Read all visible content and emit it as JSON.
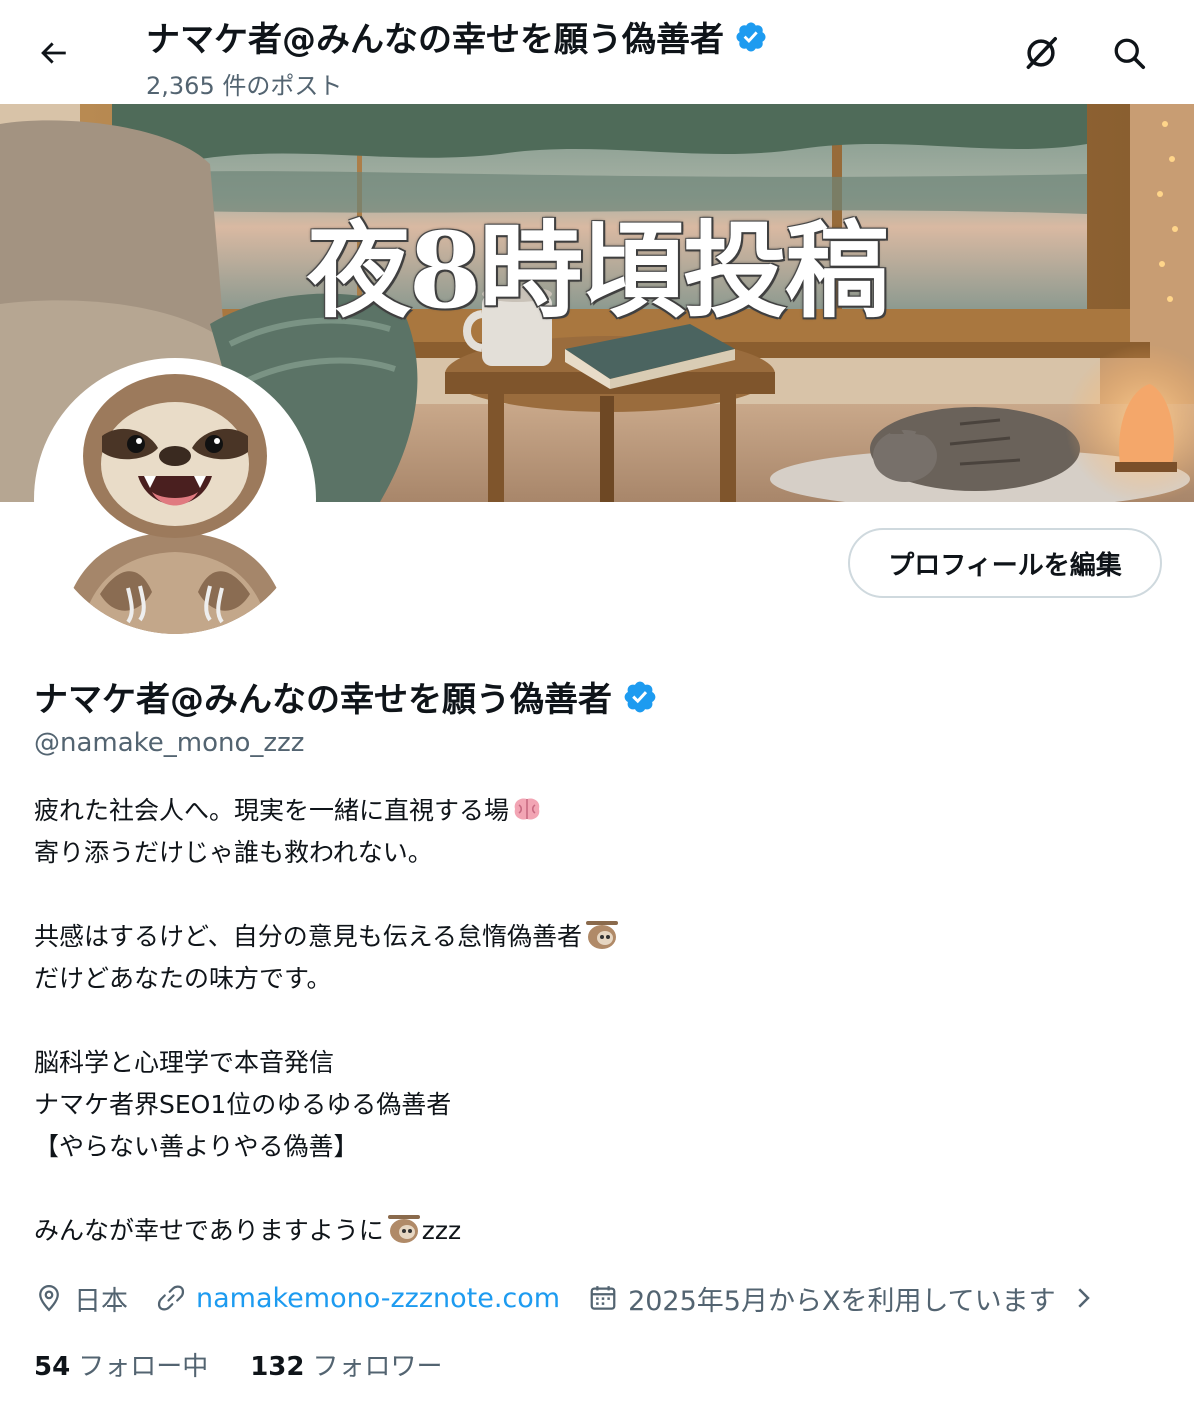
{
  "header": {
    "title": "ナマケ者@みんなの幸せを願う偽善者",
    "post_count": "2,365 件のポスト",
    "back_icon": "arrow-left-icon",
    "grok_icon": "grok-icon",
    "search_icon": "search-icon"
  },
  "banner": {
    "text": "夜8時頃投稿"
  },
  "profile": {
    "edit_button": "プロフィールを編集",
    "display_name": "ナマケ者@みんなの幸せを願う偽善者",
    "handle": "@namake_mono_zzz",
    "verified_color": "#1d9bf0",
    "bio_lines": [
      "疲れた社会人へ。現実を一緒に直視する場",
      "寄り添うだけじゃ誰も救われない。",
      "",
      "共感はするけど、自分の意見も伝える怠惰偽善者",
      "だけどあなたの味方です。",
      "",
      "脳科学と心理学で本音発信",
      "ナマケ者界SEO1位のゆるゆる偽善者",
      "【やらない善よりやる偽善】",
      "",
      "みんなが幸せでありますように",
      "zzz"
    ],
    "location": "日本",
    "website": "namakemono-zzznote.com",
    "joined": "2025年5月からXを利用しています",
    "following_count": "54",
    "following_label": "フォロー中",
    "followers_count": "132",
    "followers_label": "フォロワー",
    "link_color": "#1d9bf0"
  }
}
